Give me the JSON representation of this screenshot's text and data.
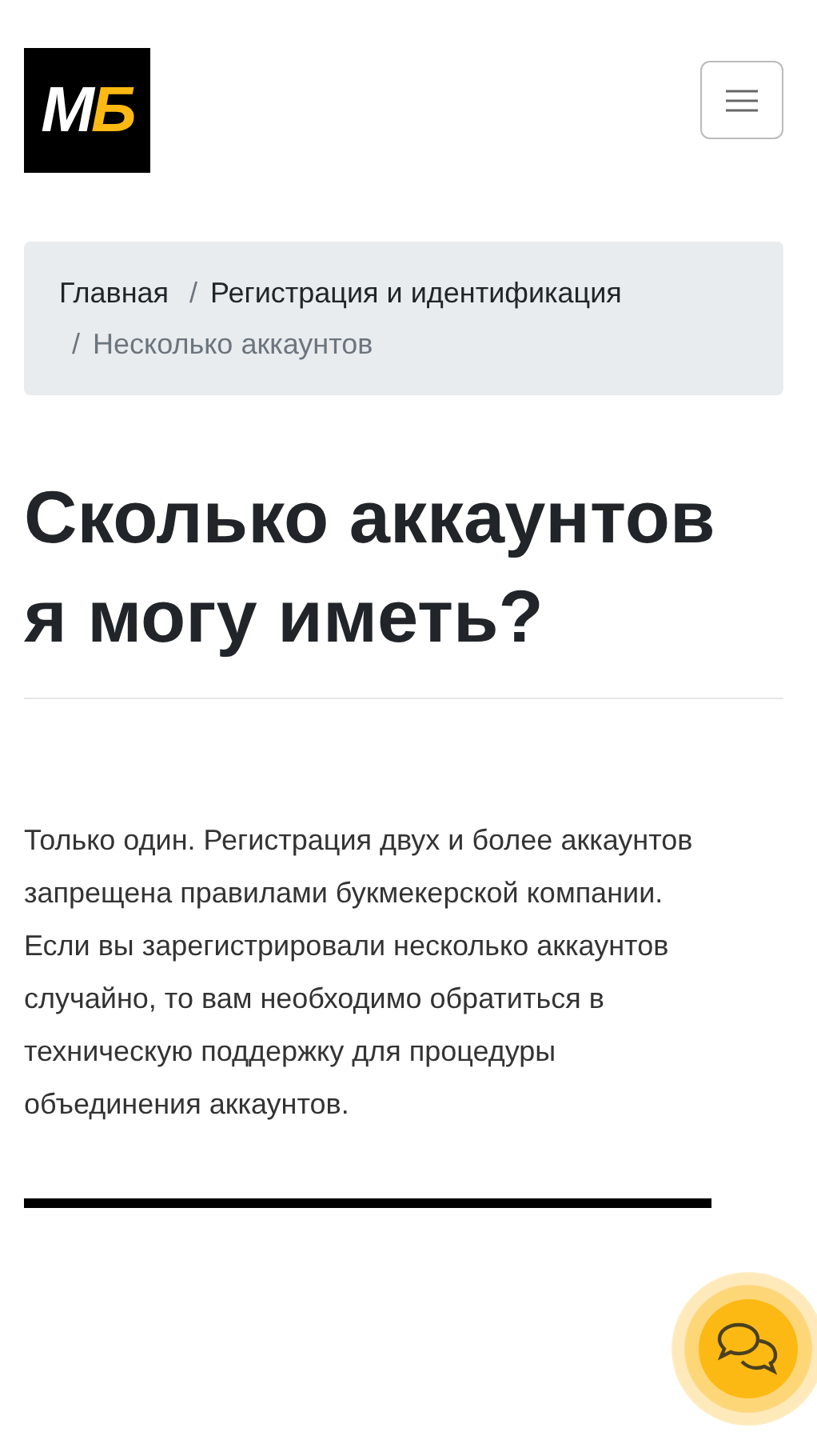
{
  "logo": {
    "letters": [
      "M",
      "Б"
    ]
  },
  "breadcrumb_separator": "/",
  "breadcrumb": [
    {
      "label": "Главная",
      "active": false
    },
    {
      "label": "Регистрация и идентификация",
      "active": false
    },
    {
      "label": "Несколько аккаунтов",
      "active": true
    }
  ],
  "title": "Сколько аккаунтов я могу иметь?",
  "body": "Только один. Регистрация двух и более аккаунтов запрещена правилами букмекерской компании. Если вы зарегистрировали несколько аккаунтов случайно, то вам необходимо обратиться в техническую поддержку для процедуры объединения аккаунтов."
}
